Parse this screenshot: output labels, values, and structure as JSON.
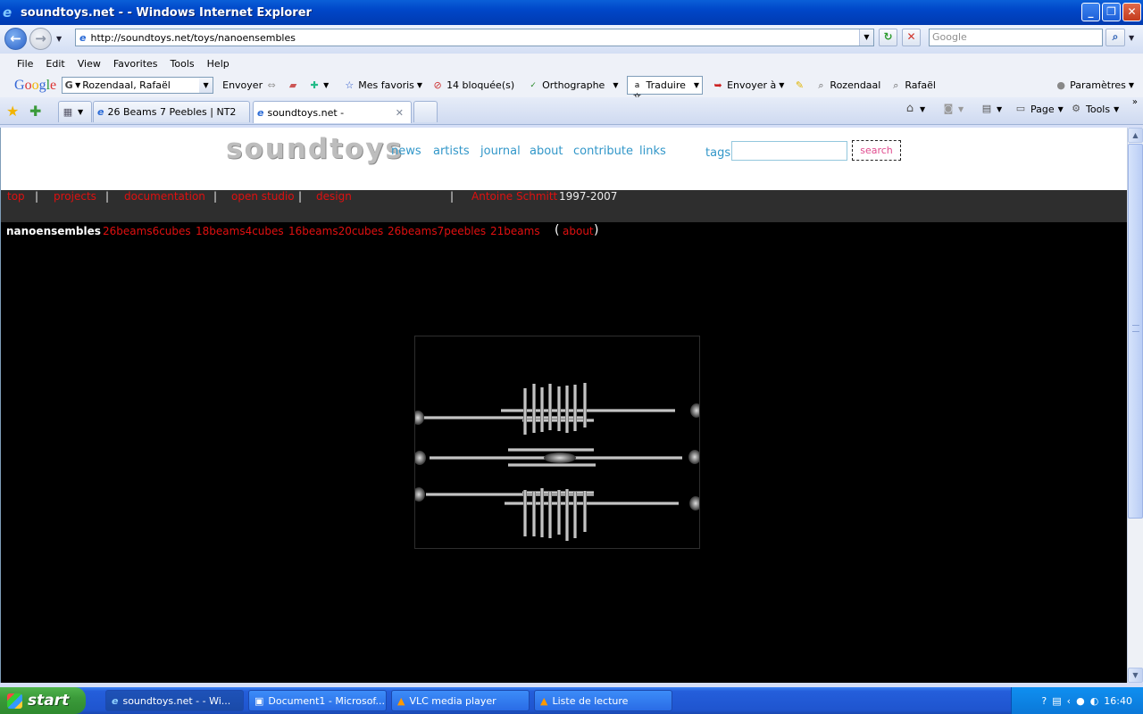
{
  "window": {
    "title": "soundtoys.net - - Windows Internet Explorer"
  },
  "address": {
    "url": "http://soundtoys.net/toys/nanoensembles",
    "search_placeholder": "Google"
  },
  "menu": [
    "File",
    "Edit",
    "View",
    "Favorites",
    "Tools",
    "Help"
  ],
  "google_bar": {
    "logo": "Google",
    "account": "Rozendaal, Rafaël",
    "send": "Envoyer",
    "favorites": "Mes favoris",
    "blocked": "14 bloquée(s)",
    "spell": "Orthographe",
    "translate": "Traduire",
    "send_to": "Envoyer à",
    "user1": "Rozendaal",
    "user2": "Rafaël",
    "settings": "Paramètres"
  },
  "tabs": [
    {
      "label": "26 Beams 7 Peebles | NT2",
      "active": false
    },
    {
      "label": "soundtoys.net -",
      "active": true
    }
  ],
  "right_tools": {
    "page": "Page",
    "tools": "Tools"
  },
  "site": {
    "logo": "soundtoys",
    "nav": [
      "news",
      "artists",
      "journal",
      "about",
      "contribute",
      "links"
    ],
    "tags_label": "tags",
    "search_label": "search",
    "crumbs": [
      "top",
      "projects",
      "documentation",
      "open studio",
      "design"
    ],
    "separator": "|",
    "artist": "Antoine Schmitt",
    "years": "1997-2007",
    "sub_title": "nanoensembles",
    "sub_links": [
      "26beams6cubes",
      "18beams4cubes",
      "16beams20cubes",
      "26beams7peebles",
      "21beams"
    ],
    "about_link": "about",
    "paren_open": "(",
    "paren_close": ")"
  },
  "taskbar": {
    "start": "start",
    "items": [
      {
        "label": "soundtoys.net - - Wi...",
        "active": true
      },
      {
        "label": "Document1 - Microsof...",
        "active": false
      },
      {
        "label": "VLC media player",
        "active": false
      },
      {
        "label": "Liste de lecture",
        "active": false
      }
    ],
    "clock": "16:40"
  },
  "colors": {
    "site_link": "#3297c9",
    "crumb_red": "#e01010",
    "search_pink": "#e04b8e"
  }
}
